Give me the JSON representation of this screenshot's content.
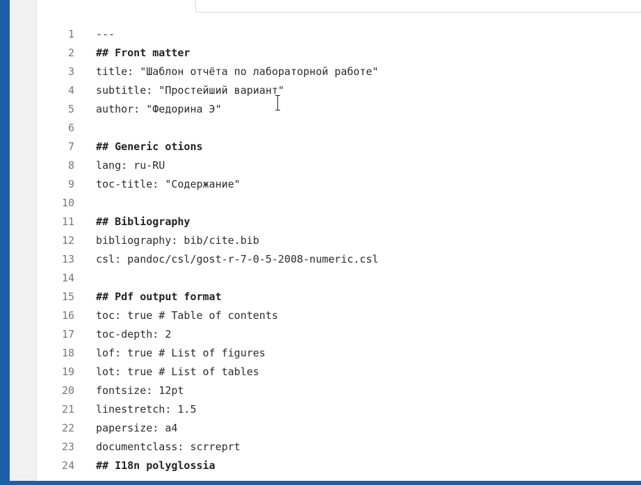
{
  "editor": {
    "lines": [
      {
        "number": "1",
        "text": "---",
        "heading": false
      },
      {
        "number": "2",
        "text": "## Front matter",
        "heading": true
      },
      {
        "number": "3",
        "text": "title: \"Шаблон отчёта по лабораторной работе\"",
        "heading": false
      },
      {
        "number": "4",
        "text": "subtitle: \"Простейший вариант\"",
        "heading": false
      },
      {
        "number": "5",
        "text": "author: \"Федорина Э\"",
        "heading": false
      },
      {
        "number": "6",
        "text": "",
        "heading": false
      },
      {
        "number": "7",
        "text": "## Generic otions",
        "heading": true
      },
      {
        "number": "8",
        "text": "lang: ru-RU",
        "heading": false
      },
      {
        "number": "9",
        "text": "toc-title: \"Содержание\"",
        "heading": false
      },
      {
        "number": "10",
        "text": "",
        "heading": false
      },
      {
        "number": "11",
        "text": "## Bibliography",
        "heading": true
      },
      {
        "number": "12",
        "text": "bibliography: bib/cite.bib",
        "heading": false
      },
      {
        "number": "13",
        "text": "csl: pandoc/csl/gost-r-7-0-5-2008-numeric.csl",
        "heading": false
      },
      {
        "number": "14",
        "text": "",
        "heading": false
      },
      {
        "number": "15",
        "text": "## Pdf output format",
        "heading": true
      },
      {
        "number": "16",
        "text": "toc: true # Table of contents",
        "heading": false
      },
      {
        "number": "17",
        "text": "toc-depth: 2",
        "heading": false
      },
      {
        "number": "18",
        "text": "lof: true # List of figures",
        "heading": false
      },
      {
        "number": "19",
        "text": "lot: true # List of tables",
        "heading": false
      },
      {
        "number": "20",
        "text": "fontsize: 12pt",
        "heading": false
      },
      {
        "number": "21",
        "text": "linestretch: 1.5",
        "heading": false
      },
      {
        "number": "22",
        "text": "papersize: a4",
        "heading": false
      },
      {
        "number": "23",
        "text": "documentclass: scrreprt",
        "heading": false
      },
      {
        "number": "24",
        "text": "## I18n polyglossia",
        "heading": true
      }
    ]
  },
  "colors": {
    "window_border": "#1e5ea8",
    "gutter_background": "#f1f1f1",
    "line_number": "#777777",
    "text": "#2b2b2b"
  },
  "icons": {
    "cursor": "text-cursor-icon"
  }
}
